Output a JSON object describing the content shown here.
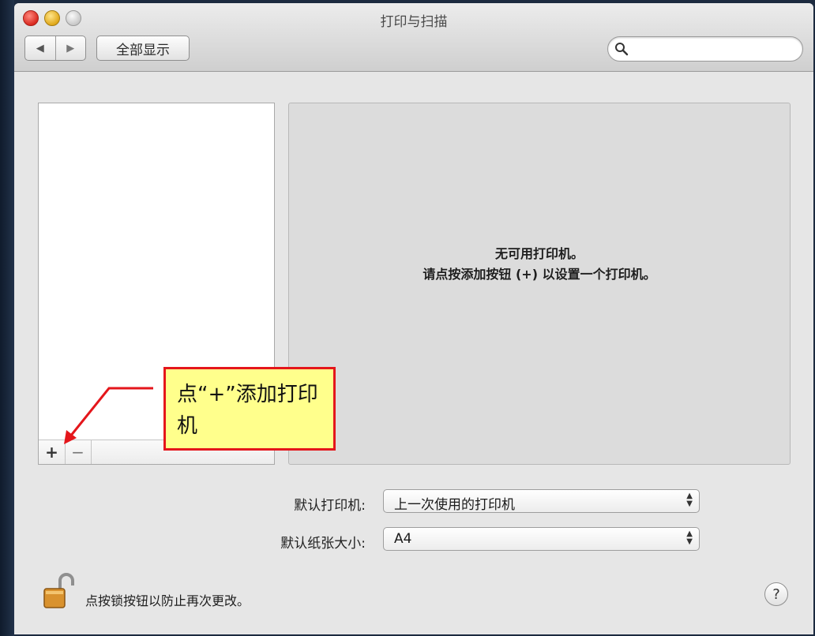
{
  "window": {
    "title": "打印与扫描",
    "nav_back": "◀",
    "nav_forward": "▶",
    "show_all_label": "全部显示",
    "search_placeholder": ""
  },
  "printer_list": {
    "items": [],
    "add_label": "+",
    "remove_label": "−"
  },
  "detail": {
    "empty_line1": "无可用打印机。",
    "empty_line2": "请点按添加按钮 (+) 以设置一个打印机。"
  },
  "callout": {
    "text": "点“+”添加打印机",
    "border_color": "#e4161b",
    "fill_color": "#ffff8c"
  },
  "settings": {
    "default_printer_label": "默认打印机:",
    "default_printer_value": "上一次使用的打印机",
    "default_paper_label": "默认纸张大小:",
    "default_paper_value": "A4"
  },
  "footer": {
    "lock_text": "点按锁按钮以防止再次更改。",
    "help_label": "?"
  }
}
